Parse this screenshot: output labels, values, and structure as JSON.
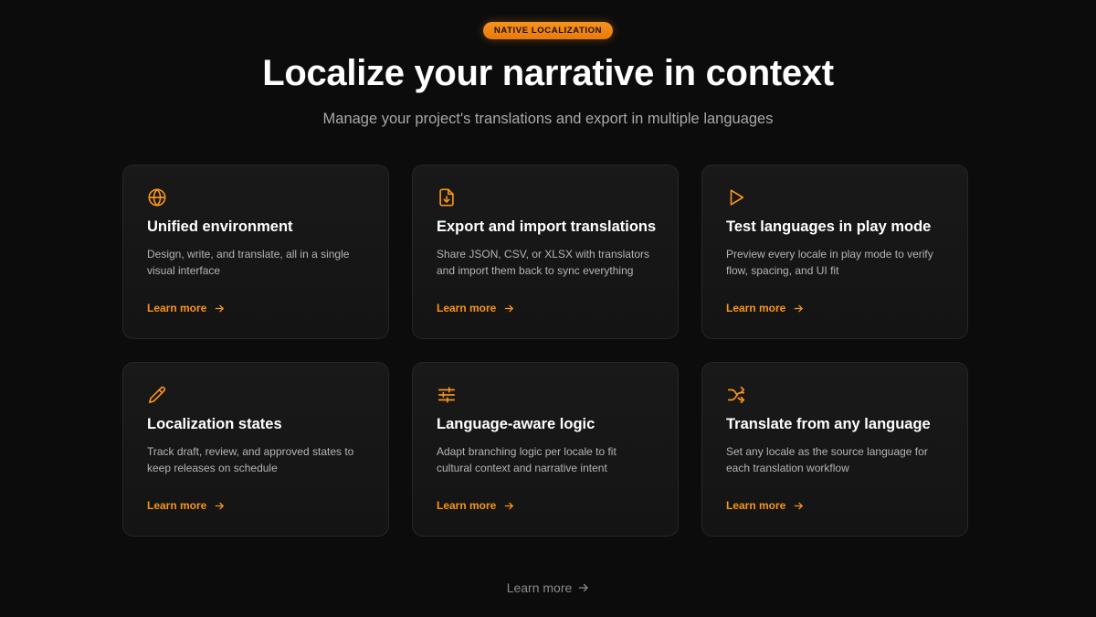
{
  "hero": {
    "badge": "NATIVE LOCALIZATION",
    "title": "Localize your narrative in context",
    "subtitle": "Manage your project's translations and export in multiple languages"
  },
  "theme": {
    "accent": "#f7941d",
    "background": "#0c0c0c",
    "card_background": "#171717"
  },
  "cards": [
    {
      "icon": "globe-icon",
      "title": "Unified environment",
      "description": "Design, write, and translate, all in a single visual interface",
      "link": "Learn more"
    },
    {
      "icon": "file-download-icon",
      "title": "Export and import translations",
      "description": "Share JSON, CSV, or XLSX with translators and import them back to sync everything",
      "link": "Learn more"
    },
    {
      "icon": "play-icon",
      "title": "Test languages in play mode",
      "description": "Preview every locale in play mode to verify flow, spacing, and UI fit",
      "link": "Learn more"
    },
    {
      "icon": "pencil-icon",
      "title": "Localization states",
      "description": "Track draft, review, and approved states to keep releases on schedule",
      "link": "Learn more"
    },
    {
      "icon": "sliders-icon",
      "title": "Language-aware logic",
      "description": "Adapt branching logic per locale to fit cultural context and narrative intent",
      "link": "Learn more"
    },
    {
      "icon": "shuffle-icon",
      "title": "Translate from any language",
      "description": "Set any locale as the source language for each translation workflow",
      "link": "Learn more"
    }
  ],
  "footer": {
    "link": "Learn more"
  }
}
